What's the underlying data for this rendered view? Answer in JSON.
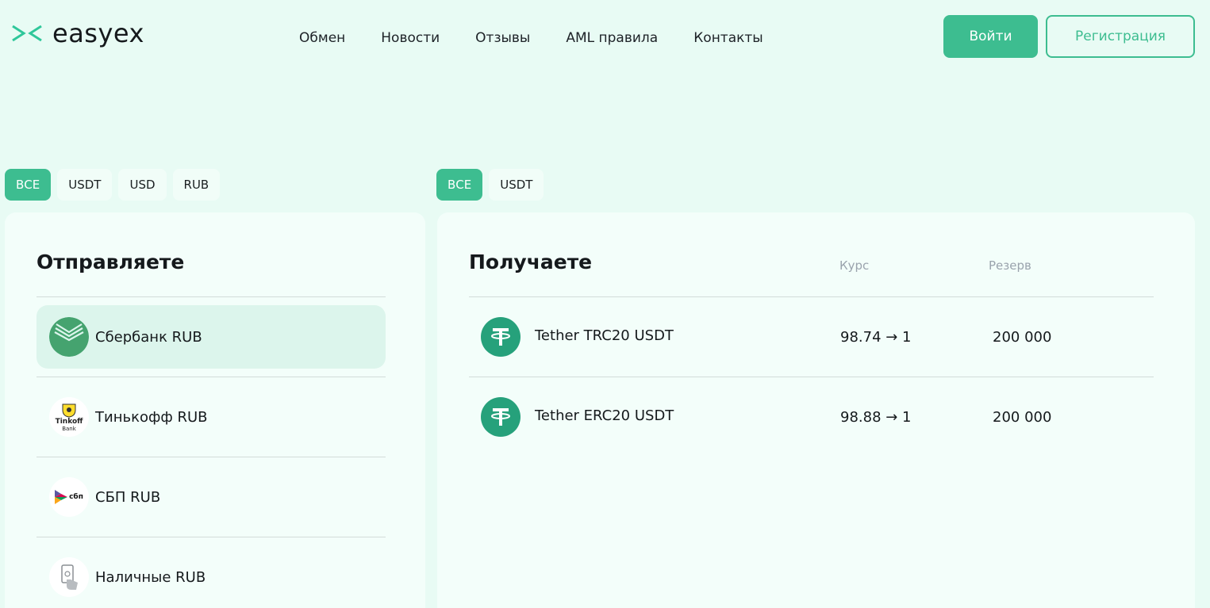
{
  "header": {
    "logo_text": "easyex",
    "nav": [
      "Обмен",
      "Новости",
      "Отзывы",
      "AML правила",
      "Контакты"
    ],
    "login_label": "Войти",
    "register_label": "Регистрация"
  },
  "colors": {
    "accent": "#3dbd90",
    "background": "#e8fbf4",
    "tether": "#26a17b",
    "sber": "#3ea06a"
  },
  "send_filters": {
    "tabs": [
      "ВСЕ",
      "USDT",
      "USD",
      "RUB"
    ],
    "active": "ВСЕ"
  },
  "receive_filters": {
    "tabs": [
      "ВСЕ",
      "USDT"
    ],
    "active": "ВСЕ"
  },
  "send": {
    "title": "Отправляете",
    "items": [
      {
        "label": "Сбербанк RUB",
        "icon": "sberbank-icon",
        "selected": true
      },
      {
        "label": "Тинькофф RUB",
        "icon": "tinkoff-icon",
        "icon_text": "Tinkoff",
        "icon_sub": "Bank"
      },
      {
        "label": "СБП RUB",
        "icon": "sbp-icon",
        "icon_text": "сбп"
      },
      {
        "label": "Наличные RUB",
        "icon": "cash-icon"
      }
    ]
  },
  "receive": {
    "title": "Получаете",
    "col_rate": "Курс",
    "col_reserve": "Резерв",
    "rows": [
      {
        "name": "Tether TRC20 USDT",
        "rate": "98.74 → 1",
        "reserve": "200 000",
        "icon": "tether-icon"
      },
      {
        "name": "Tether ERC20 USDT",
        "rate": "98.88 → 1",
        "reserve": "200 000",
        "icon": "tether-icon"
      }
    ]
  }
}
